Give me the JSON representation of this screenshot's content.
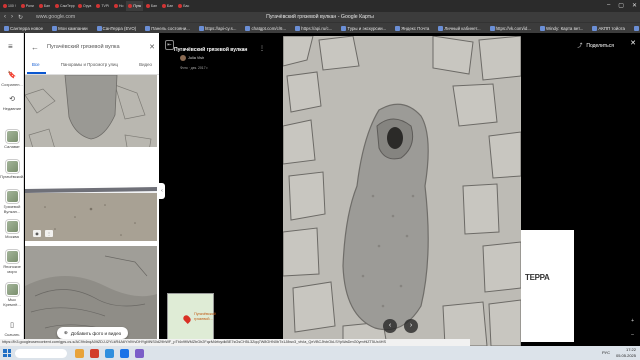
{
  "browser": {
    "tabs": [
      "100 !",
      "Роли",
      "Бан",
      "СамТерр",
      "Оруа",
      "TVPi",
      "Но",
      "Пуга",
      "Бан",
      "Бан",
      "Бас"
    ],
    "active_tab": 7,
    "url": "www.google.com",
    "page_title": "Пугачёвский грязевой вулкан - Google Карты",
    "bookmarks": [
      "Сантерра новое",
      "Мои кампании",
      "СанТерра (EVO)",
      "Панель состояни...",
      "https://api-cy.s...",
      "chatgpt.com/c/6...",
      "https://api.ru/c...",
      "Туры и экскурсии...",
      "Яндекс Почта",
      "Личный кабинет...",
      "https://vk.com/id...",
      "Windy: Карта вет...",
      "АКПП тойота",
      "https://roundcub...",
      "Вкладки"
    ]
  },
  "rail": {
    "items": [
      {
        "label": "Сохранен...",
        "icon": "bookmark-icon"
      },
      {
        "label": "Недавние",
        "icon": "history-icon"
      },
      {
        "label": "Салават",
        "icon": "place-thumb"
      },
      {
        "label": "Пугачёвский...",
        "icon": "place-thumb"
      },
      {
        "label": "Грязевой Вулкан...",
        "icon": "place-thumb"
      },
      {
        "label": "Москва",
        "icon": "place-thumb"
      },
      {
        "label": "Японские моря",
        "icon": "place-thumb"
      },
      {
        "label": "Мыс Кремлё...",
        "icon": "place-thumb"
      },
      {
        "label": "Скачать прилож...",
        "icon": "phone-icon"
      }
    ]
  },
  "panel": {
    "search_value": "Пугачёвский грязевой вулка",
    "tabs": [
      "Все",
      "Панорамы и Просмотр улиц",
      "Видео"
    ],
    "add_photo_label": "Добавить фото и видео"
  },
  "infobox": {
    "title": "Пугачёвский грязевой вулкан",
    "author": "Julia Vish",
    "meta": "Фото · дек. 2017 г."
  },
  "minimap": {
    "label": "Пугачёвский грязевой..."
  },
  "viewer": {
    "share_label": "Поделиться",
    "banner_text": "ТЕРРА"
  },
  "status_url": "https://lh3.googleusercontent.com/gps-cs-s/AC9h4nqA0ltZDJ-l2YLkR4A6Yh9VvDHYgMNS0d29hWF_pTt4x9fWMZbGh2FqzM4rfoydkBE7sGsCH5L3Zqq7W8GHN0bTx1J8wx3_vfvIa_QeVBCJfvbOkLSYpWaDmG0ymHiZT5Ux4HS",
  "taskbar": {
    "time": "17:22",
    "date": "05.05.2025",
    "lang": "РУС"
  }
}
